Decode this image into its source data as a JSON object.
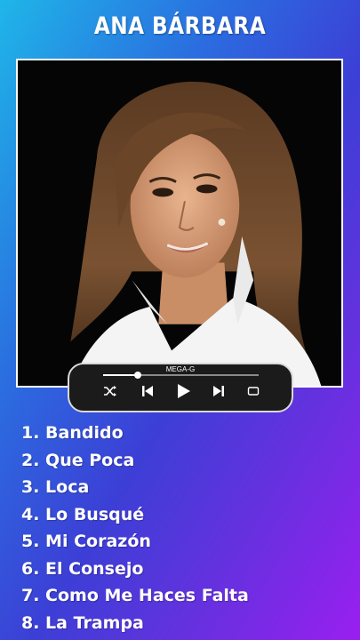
{
  "header": {
    "title": "ANA BÁRBARA"
  },
  "player": {
    "label": "MEGA-G",
    "progress": 0.22,
    "icons": [
      "shuffle-icon",
      "previous-icon",
      "play-icon",
      "next-icon",
      "repeat-icon"
    ]
  },
  "songs": [
    "1. Bandido",
    "2. Que Poca",
    "3. Loca",
    "4. Lo Busqué",
    "5. Mi Corazón",
    "6. El Consejo",
    "7. Como Me Haces Falta",
    "8. La Trampa"
  ],
  "colors": {
    "gradient_start": "#1fb6e8",
    "gradient_end": "#9a1ff0",
    "player_bg": "#1b1b1b",
    "text": "#ffffff"
  }
}
